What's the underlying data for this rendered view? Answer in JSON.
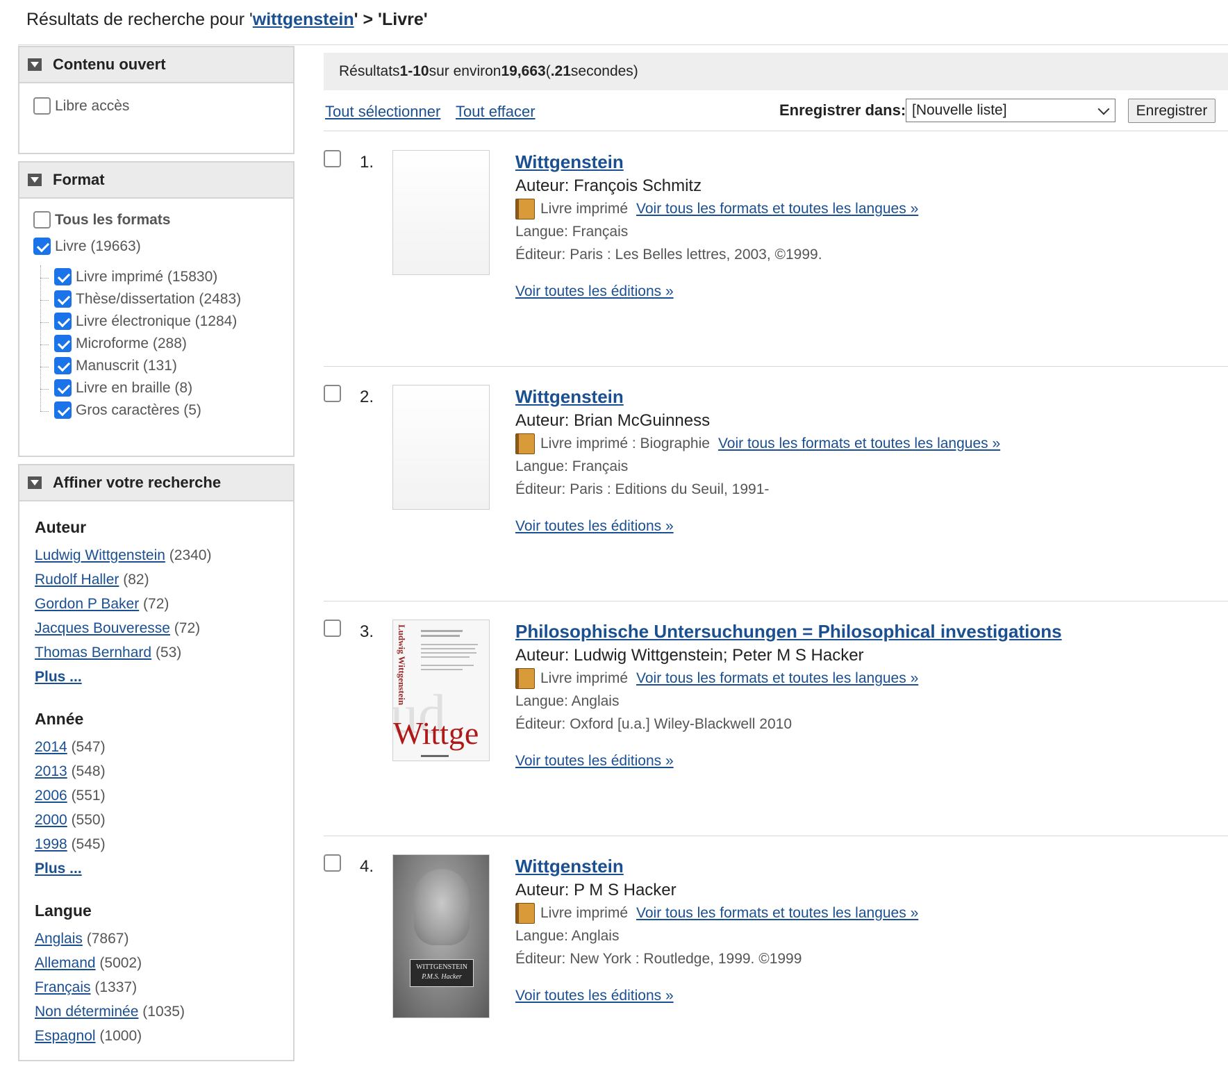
{
  "header": {
    "prefix": "Résultats de recherche pour '",
    "query": "wittgenstein",
    "sep": "' > '",
    "format": "Livre",
    "suffix": "'"
  },
  "sidebar": {
    "open_content": {
      "title": "Contenu ouvert",
      "libre_acces": "Libre accès"
    },
    "format": {
      "title": "Format",
      "all": "Tous les formats",
      "livre": "Livre (19663)",
      "subs": [
        "Livre imprimé (15830)",
        "Thèse/dissertation (2483)",
        "Livre électronique (1284)",
        "Microforme (288)",
        "Manuscrit (131)",
        "Livre en braille (8)",
        "Gros caractères (5)"
      ]
    },
    "refine": {
      "title": "Affiner votre recherche",
      "author": {
        "heading": "Auteur",
        "items": [
          {
            "name": "Ludwig Wittgenstein",
            "count": "(2340)"
          },
          {
            "name": "Rudolf Haller",
            "count": "(82)"
          },
          {
            "name": "Gordon P Baker",
            "count": "(72)"
          },
          {
            "name": "Jacques Bouveresse",
            "count": "(72)"
          },
          {
            "name": "Thomas Bernhard",
            "count": "(53)"
          }
        ],
        "more": "Plus ..."
      },
      "year": {
        "heading": "Année",
        "items": [
          {
            "name": "2014",
            "count": "(547)"
          },
          {
            "name": "2013",
            "count": "(548)"
          },
          {
            "name": "2006",
            "count": "(551)"
          },
          {
            "name": "2000",
            "count": "(550)"
          },
          {
            "name": "1998",
            "count": "(545)"
          }
        ],
        "more": "Plus ..."
      },
      "language": {
        "heading": "Langue",
        "items": [
          {
            "name": "Anglais",
            "count": "(7867)"
          },
          {
            "name": "Allemand",
            "count": "(5002)"
          },
          {
            "name": "Français",
            "count": "(1337)"
          },
          {
            "name": "Non déterminée",
            "count": "(1035)"
          },
          {
            "name": "Espagnol",
            "count": "(1000)"
          }
        ]
      }
    }
  },
  "results_bar": {
    "label": "Résultats ",
    "range": "1-10",
    "mid": " sur environ ",
    "total": "19,663",
    "time_open": " (",
    "time": ".21",
    "time_close": " secondes)"
  },
  "toolbar": {
    "select_all": "Tout sélectionner",
    "clear_all": "Tout effacer",
    "save_in": "Enregistrer dans:",
    "list_value": "[Nouvelle liste]",
    "save": "Enregistrer"
  },
  "results": [
    {
      "num": "1.",
      "title": "Wittgenstein",
      "author": "Auteur: François Schmitz",
      "format": "Livre imprimé",
      "all_formats": "Voir tous les formats et toutes les langues »",
      "language": "Langue: Français",
      "publisher": "Éditeur: Paris : Les Belles lettres, 2003, ©1999.",
      "editions": "Voir toutes les éditions »"
    },
    {
      "num": "2.",
      "title": "Wittgenstein",
      "author": "Auteur: Brian McGuinness",
      "format": "Livre imprimé : Biographie",
      "all_formats": "Voir tous les formats et toutes les langues »",
      "language": "Langue: Français",
      "publisher": "Éditeur: Paris : Editions du Seuil, 1991-",
      "editions": "Voir toutes les éditions »"
    },
    {
      "num": "3.",
      "title": "Philosophische Untersuchungen = Philosophical investigations",
      "author": "Auteur: Ludwig Wittgenstein; Peter M S Hacker",
      "format": "Livre imprimé",
      "all_formats": "Voir tous les formats et toutes les langues »",
      "language": "Langue: Anglais",
      "publisher": "Éditeur: Oxford [u.a.] Wiley-Blackwell 2010",
      "editions": "Voir toutes les éditions »"
    },
    {
      "num": "4.",
      "title": "Wittgenstein",
      "author": "Auteur: P M S Hacker",
      "format": "Livre imprimé",
      "all_formats": "Voir tous les formats et toutes les langues »",
      "language": "Langue: Anglais",
      "publisher": "Éditeur: New York : Routledge, 1999. ©1999",
      "editions": "Voir toutes les éditions »"
    }
  ],
  "covers": {
    "c3_spine": "Ludwig Wittgenstein",
    "c3_big": "Wittge",
    "c4_title": "WITTGENSTEIN",
    "c4_author": "P.M.S. Hacker"
  }
}
